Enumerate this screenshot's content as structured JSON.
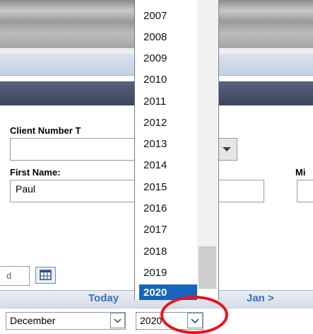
{
  "form": {
    "client_number_label": "Client Number T",
    "client_number_value": "",
    "first_name_label": "First Name:",
    "first_name_value": "Paul",
    "middle_label": "Mi",
    "date_field_partial": "d"
  },
  "calendar": {
    "today_label": "Today",
    "next_month_label": "Jan >",
    "month_select": "December",
    "year_select": "2020"
  },
  "year_dropdown": {
    "options": [
      "2007",
      "2008",
      "2009",
      "2010",
      "2011",
      "2012",
      "2013",
      "2014",
      "2015",
      "2016",
      "2017",
      "2018",
      "2019",
      "2020"
    ],
    "selected": "2020"
  },
  "colors": {
    "selection": "#1565c0",
    "link": "#3f6fb5",
    "highlight_circle": "#e8141a",
    "section_bar": "#4a5470"
  },
  "icons": {
    "calendar": "calendar-icon",
    "dropdown": "chevron-down-icon"
  }
}
